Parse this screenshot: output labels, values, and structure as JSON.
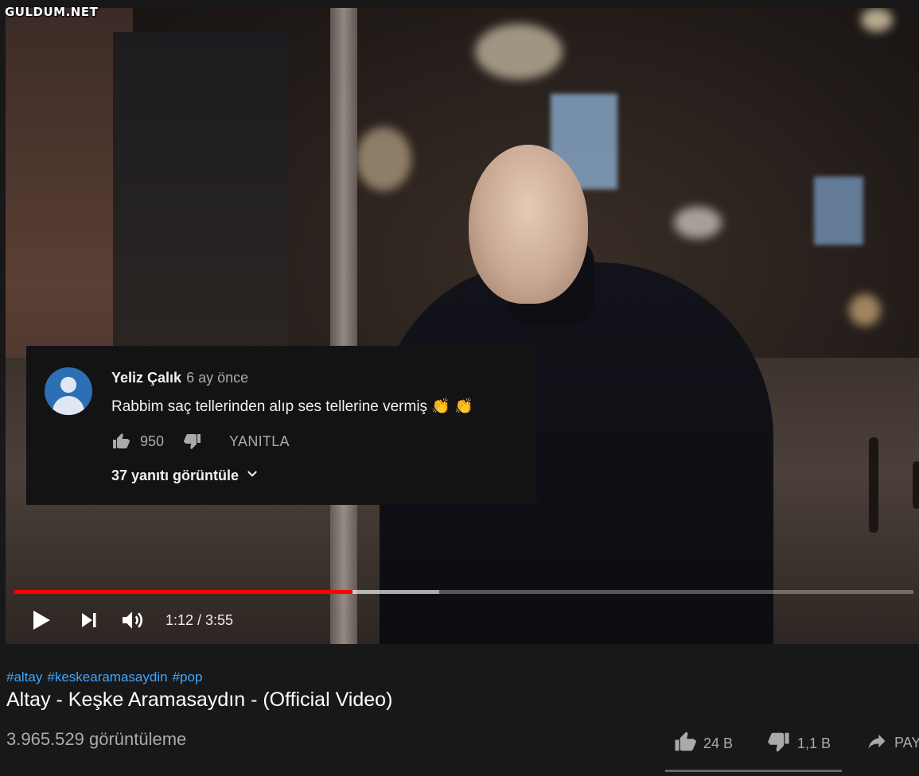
{
  "watermark": "GULDUM.NET",
  "comment": {
    "author": "Yeliz Çalık",
    "time": "6 ay önce",
    "text": "Rabbim saç tellerinden alıp ses tellerine vermiş 👏 👏",
    "likes": "950",
    "reply_label": "YANITLA",
    "view_replies": "37 yanıtı görüntüle"
  },
  "player": {
    "progress_played": 0.376,
    "progress_buffered": 0.473,
    "time": "1:12 / 3:55"
  },
  "video": {
    "tags": [
      "#altay",
      "#keskearamasaydin",
      "#pop"
    ],
    "title": "Altay - Keşke Aramasaydın - (Official Video)",
    "views": "3.965.529 görüntüleme",
    "likes": "24 B",
    "dislikes": "1,1 B",
    "share_label": "PAYLAŞ"
  },
  "colors": {
    "progress": "#ff0000",
    "link": "#3ea6ff",
    "avatar": "#2d6fb5"
  }
}
